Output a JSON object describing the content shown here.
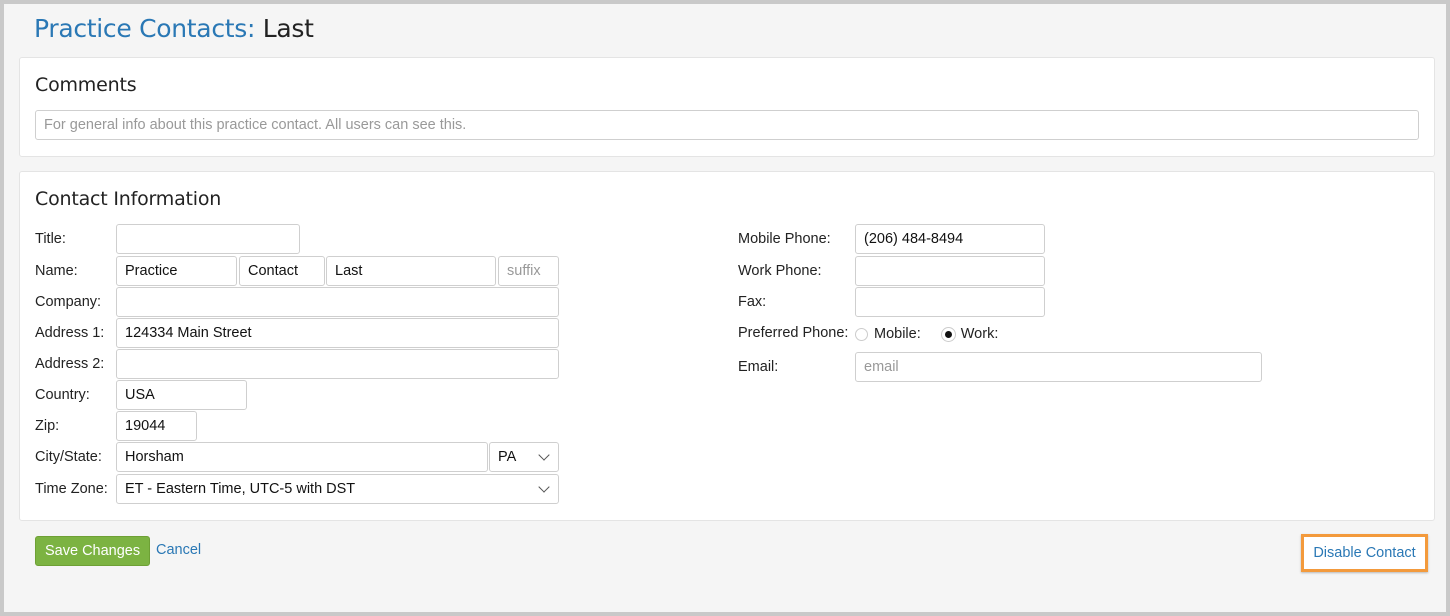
{
  "header": {
    "section": "Practice Contacts:",
    "name": "Last"
  },
  "comments": {
    "title": "Comments",
    "placeholder": "For general info about this practice contact. All users can see this.",
    "value": ""
  },
  "contact": {
    "title": "Contact Information",
    "labels": {
      "title": "Title:",
      "name": "Name:",
      "company": "Company:",
      "address1": "Address 1:",
      "address2": "Address 2:",
      "country": "Country:",
      "zip": "Zip:",
      "city_state": "City/State:",
      "time_zone": "Time Zone:",
      "mobile_phone": "Mobile Phone:",
      "work_phone": "Work Phone:",
      "fax": "Fax:",
      "preferred_phone": "Preferred Phone:",
      "email": "Email:"
    },
    "values": {
      "title": "",
      "first_name": "Practice",
      "middle_name": "Contact",
      "last_name": "Last",
      "suffix": "",
      "company": "",
      "address1": "124334 Main Street",
      "address2": "",
      "country": "USA",
      "zip": "19044",
      "city": "Horsham",
      "state": "PA",
      "time_zone": "ET - Eastern Time, UTC-5 with DST",
      "mobile_phone": "(206) 484-8494",
      "work_phone": "",
      "fax": "",
      "email": ""
    },
    "placeholders": {
      "suffix": "suffix",
      "email": "email"
    },
    "preferred_phone": {
      "options": [
        "Mobile:",
        "Work:"
      ],
      "selected": "Work:"
    }
  },
  "actions": {
    "save": "Save Changes",
    "cancel": "Cancel",
    "disable": "Disable Contact"
  },
  "colors": {
    "link": "#2a78b5",
    "save_button": "#7cb342",
    "highlight": "#f39a3c"
  }
}
